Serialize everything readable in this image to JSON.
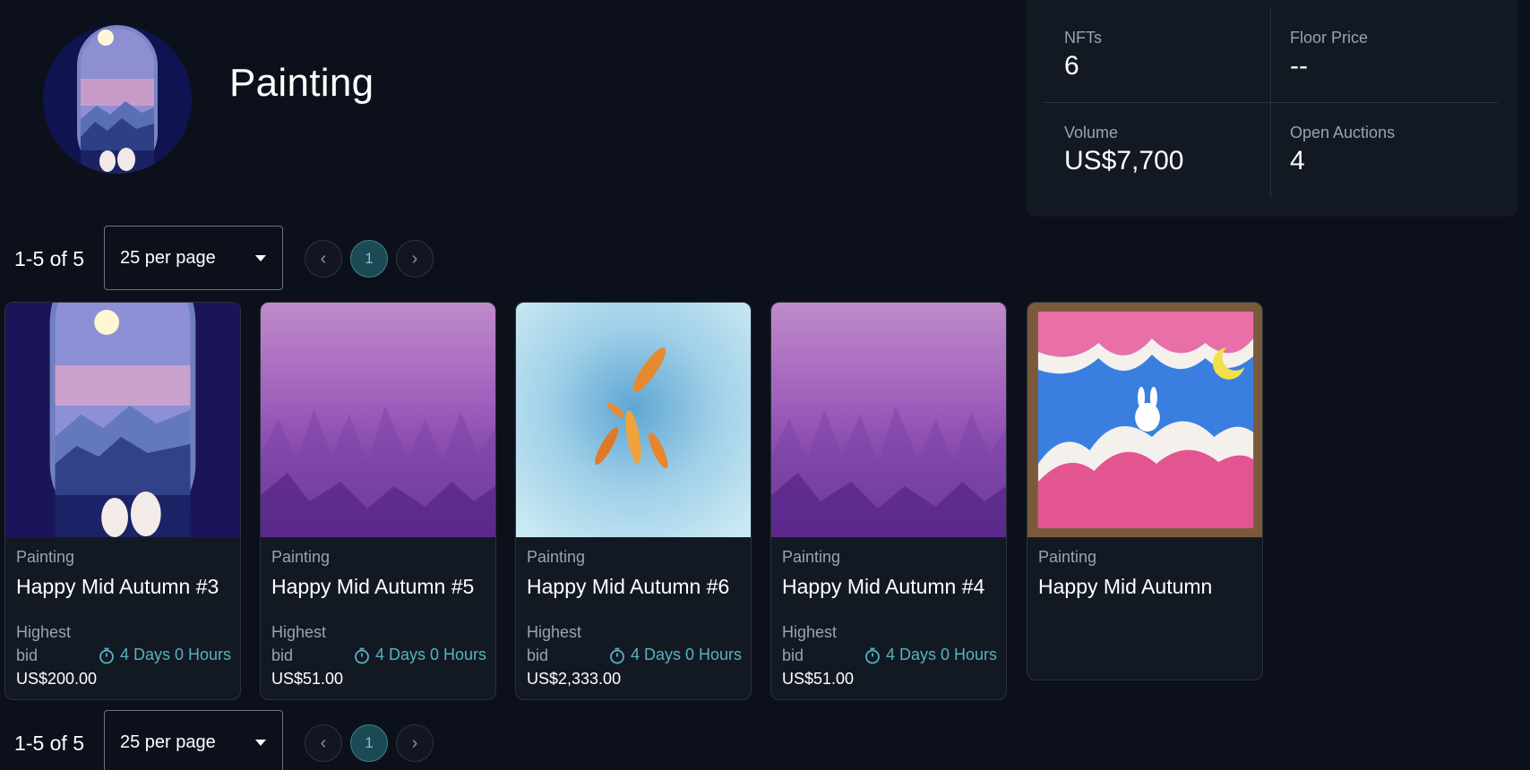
{
  "collection": {
    "title": "Painting"
  },
  "stats": {
    "nfts_label": "NFTs",
    "nfts_value": "6",
    "floor_label": "Floor Price",
    "floor_value": "--",
    "volume_label": "Volume",
    "volume_value": "US$7,700",
    "auctions_label": "Open Auctions",
    "auctions_value": "4"
  },
  "pagination": {
    "range": "1-5 of 5",
    "per_page": "25 per page",
    "prev": "‹",
    "current": "1",
    "next": "›"
  },
  "cards": [
    {
      "category": "Painting",
      "name": "Happy Mid Autumn #3",
      "bid_line1": "Highest",
      "bid_line2": "bid",
      "time": "4 Days 0 Hours",
      "price": "US$200.00",
      "art": "moon-cats"
    },
    {
      "category": "Painting",
      "name": "Happy Mid Autumn #5",
      "bid_line1": "Highest",
      "bid_line2": "bid",
      "time": "4 Days 0 Hours",
      "price": "US$51.00",
      "art": "purple-forest"
    },
    {
      "category": "Painting",
      "name": "Happy Mid Autumn #6",
      "bid_line1": "Highest",
      "bid_line2": "bid",
      "time": "4 Days 0 Hours",
      "price": "US$2,333.00",
      "art": "koi-pond"
    },
    {
      "category": "Painting",
      "name": "Happy Mid Autumn #4",
      "bid_line1": "Highest",
      "bid_line2": "bid",
      "time": "4 Days 0 Hours",
      "price": "US$51.00",
      "art": "purple-forest"
    },
    {
      "category": "Painting",
      "name": "Happy Mid Autumn",
      "art": "rabbit-clouds"
    }
  ],
  "colors": {
    "background": "#0c101a",
    "panel": "#131922",
    "accent": "#56b2c3",
    "muted_text": "#9aa3ae"
  }
}
